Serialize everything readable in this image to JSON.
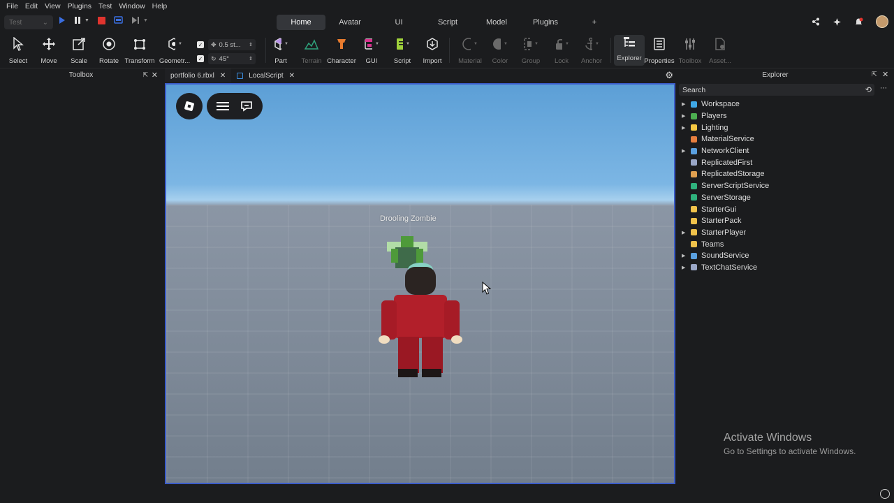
{
  "menu": [
    "File",
    "Edit",
    "View",
    "Plugins",
    "Test",
    "Window",
    "Help"
  ],
  "test_selector": "Test",
  "ribbon_tabs": [
    "Home",
    "Avatar",
    "UI",
    "Script",
    "Model",
    "Plugins"
  ],
  "ribbon_add": "+",
  "tools": {
    "select": "Select",
    "move": "Move",
    "scale": "Scale",
    "rotate": "Rotate",
    "transform": "Transform",
    "geometry": "Geometr...",
    "part": "Part",
    "terrain": "Terrain",
    "character": "Character",
    "gui": "GUI",
    "script": "Script",
    "import": "Import",
    "material": "Material",
    "color": "Color",
    "group": "Group",
    "lock": "Lock",
    "anchor": "Anchor",
    "explorer": "Explorer",
    "properties": "Properties",
    "toolbox": "Toolbox",
    "assets": "Asset..."
  },
  "snap": {
    "move_value": "0.5 st...",
    "rotate_value": "45°"
  },
  "panels": {
    "toolbox_title": "Toolbox",
    "explorer_title": "Explorer"
  },
  "doc_tabs": [
    "portfolio 6.rbxl",
    "LocalScript"
  ],
  "viewport": {
    "npc_name": "Drooling Zombie"
  },
  "explorer": {
    "search_placeholder": "Search",
    "items": [
      {
        "label": "Workspace",
        "expand": true,
        "icon": "globe-icon",
        "color": "#3fa8e6"
      },
      {
        "label": "Players",
        "expand": true,
        "icon": "players-icon",
        "color": "#4caf50"
      },
      {
        "label": "Lighting",
        "expand": true,
        "icon": "bulb-icon",
        "color": "#f5c842"
      },
      {
        "label": "MaterialService",
        "expand": false,
        "icon": "material-icon",
        "color": "#e67e3f"
      },
      {
        "label": "NetworkClient",
        "expand": true,
        "icon": "network-icon",
        "color": "#5aa0e0"
      },
      {
        "label": "ReplicatedFirst",
        "expand": false,
        "icon": "replicated-icon",
        "color": "#9aa7c7"
      },
      {
        "label": "ReplicatedStorage",
        "expand": false,
        "icon": "storage-icon",
        "color": "#e0a050"
      },
      {
        "label": "ServerScriptService",
        "expand": false,
        "icon": "server-script-icon",
        "color": "#2fb27d"
      },
      {
        "label": "ServerStorage",
        "expand": false,
        "icon": "server-storage-icon",
        "color": "#2fb27d"
      },
      {
        "label": "StarterGui",
        "expand": false,
        "icon": "folder-icon",
        "color": "#f0c24b"
      },
      {
        "label": "StarterPack",
        "expand": false,
        "icon": "folder-icon",
        "color": "#f0c24b"
      },
      {
        "label": "StarterPlayer",
        "expand": true,
        "icon": "folder-icon",
        "color": "#f0c24b"
      },
      {
        "label": "Teams",
        "expand": false,
        "icon": "folder-icon",
        "color": "#f0c24b"
      },
      {
        "label": "SoundService",
        "expand": true,
        "icon": "sound-icon",
        "color": "#5aa0e0"
      },
      {
        "label": "TextChatService",
        "expand": true,
        "icon": "chat-icon",
        "color": "#9aa7c7"
      }
    ]
  },
  "watermark": {
    "title": "Activate Windows",
    "subtitle": "Go to Settings to activate Windows."
  },
  "colors": {
    "accent": "#3b5cc9",
    "stop": "#e0342e",
    "play": "#3a6ee0"
  }
}
